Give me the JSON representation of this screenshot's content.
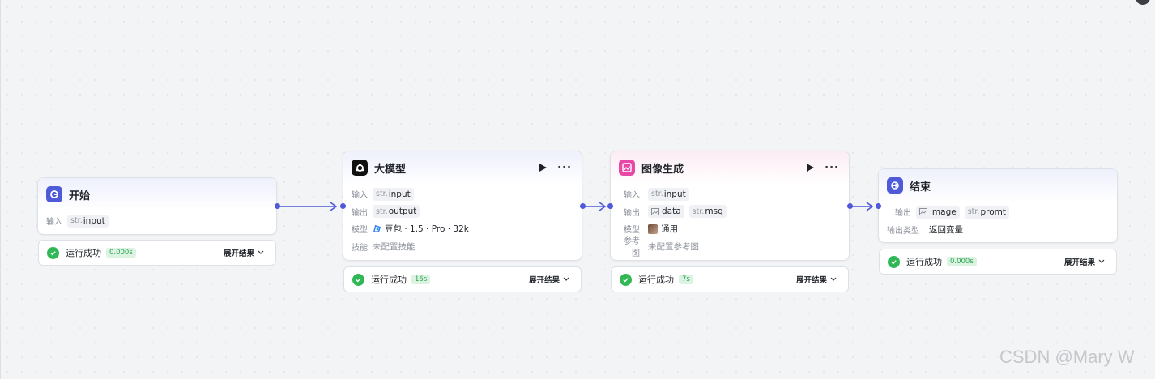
{
  "nodes": {
    "start": {
      "title": "开始",
      "input_label": "输入",
      "input_type": "str.",
      "input_name": "input",
      "status_text": "运行成功",
      "status_time": "0.000s",
      "expand_label": "展开结果"
    },
    "llm": {
      "title": "大模型",
      "input_label": "输入",
      "input_type": "str.",
      "input_name": "input",
      "output_label": "输出",
      "output_type": "str.",
      "output_name": "output",
      "model_label": "模型",
      "model_value": "豆包 · 1.5 · Pro · 32k",
      "skill_label": "技能",
      "skill_value": "未配置技能",
      "status_text": "运行成功",
      "status_time": "16s",
      "expand_label": "展开结果"
    },
    "image": {
      "title": "图像生成",
      "input_label": "输入",
      "input_type": "str.",
      "input_name": "input",
      "output_label": "输出",
      "output1_name": "data",
      "output2_type": "str.",
      "output2_name": "msg",
      "model_label": "模型",
      "model_value": "通用",
      "ref_label": "参考图",
      "ref_value": "未配置参考图",
      "status_text": "运行成功",
      "status_time": "7s",
      "expand_label": "展开结果"
    },
    "end": {
      "title": "结束",
      "output_label": "输出",
      "output1_name": "image",
      "output2_type": "str.",
      "output2_name": "promt",
      "output_type_label": "输出类型",
      "output_type_value": "返回变量",
      "status_text": "运行成功",
      "status_time": "0.000s",
      "expand_label": "展开结果"
    }
  },
  "colors": {
    "accent": "#4e5ad8",
    "success": "#30b856",
    "start_icon": "#4e5ad8",
    "image_icon": "#e74aa6",
    "end_icon": "#4e5ad8"
  },
  "icons": {
    "start": "start-icon",
    "llm": "llm-icon",
    "image": "image-gen-icon",
    "end": "end-icon",
    "run": "play-icon",
    "more": "more-icon",
    "status": "check-circle-icon",
    "expand": "chevron-down-icon"
  },
  "watermark": "CSDN @Mary W"
}
